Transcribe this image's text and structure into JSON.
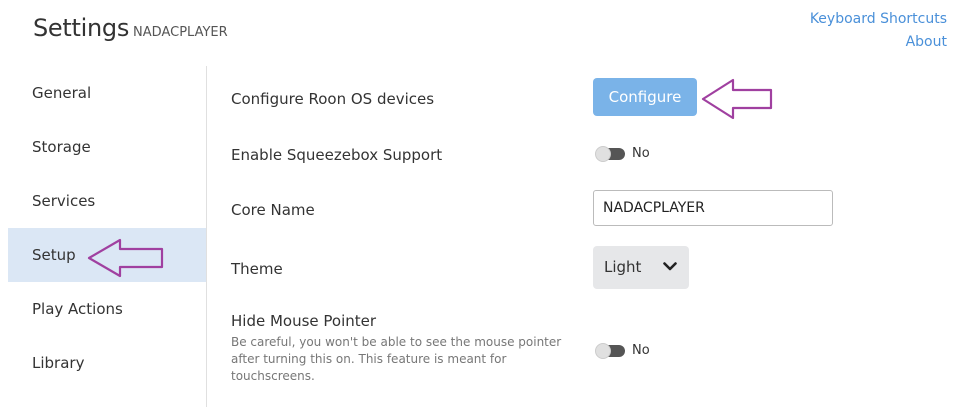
{
  "header": {
    "title": "Settings",
    "subtitle": "NADACPLAYER",
    "links": [
      "Keyboard Shortcuts",
      "About"
    ]
  },
  "sidebar": {
    "items": [
      {
        "label": "General",
        "active": false
      },
      {
        "label": "Storage",
        "active": false
      },
      {
        "label": "Services",
        "active": false
      },
      {
        "label": "Setup",
        "active": true
      },
      {
        "label": "Play Actions",
        "active": false
      },
      {
        "label": "Library",
        "active": false
      }
    ]
  },
  "setup": {
    "configure_label": "Configure Roon OS devices",
    "configure_button": "Configure",
    "squeezebox_label": "Enable Squeezebox Support",
    "squeezebox_value": "No",
    "core_name_label": "Core Name",
    "core_name_value": "NADACPLAYER",
    "theme_label": "Theme",
    "theme_value": "Light",
    "hide_pointer_label": "Hide Mouse Pointer",
    "hide_pointer_desc": "Be careful, you won't be able to see the mouse pointer after turning this on. This feature is meant for touchscreens.",
    "hide_pointer_value": "No"
  },
  "colors": {
    "accent": "#4a90d9",
    "button": "#7ab3e8",
    "active_bg": "#dbe7f5",
    "annotation_arrow": "#a040a0"
  }
}
